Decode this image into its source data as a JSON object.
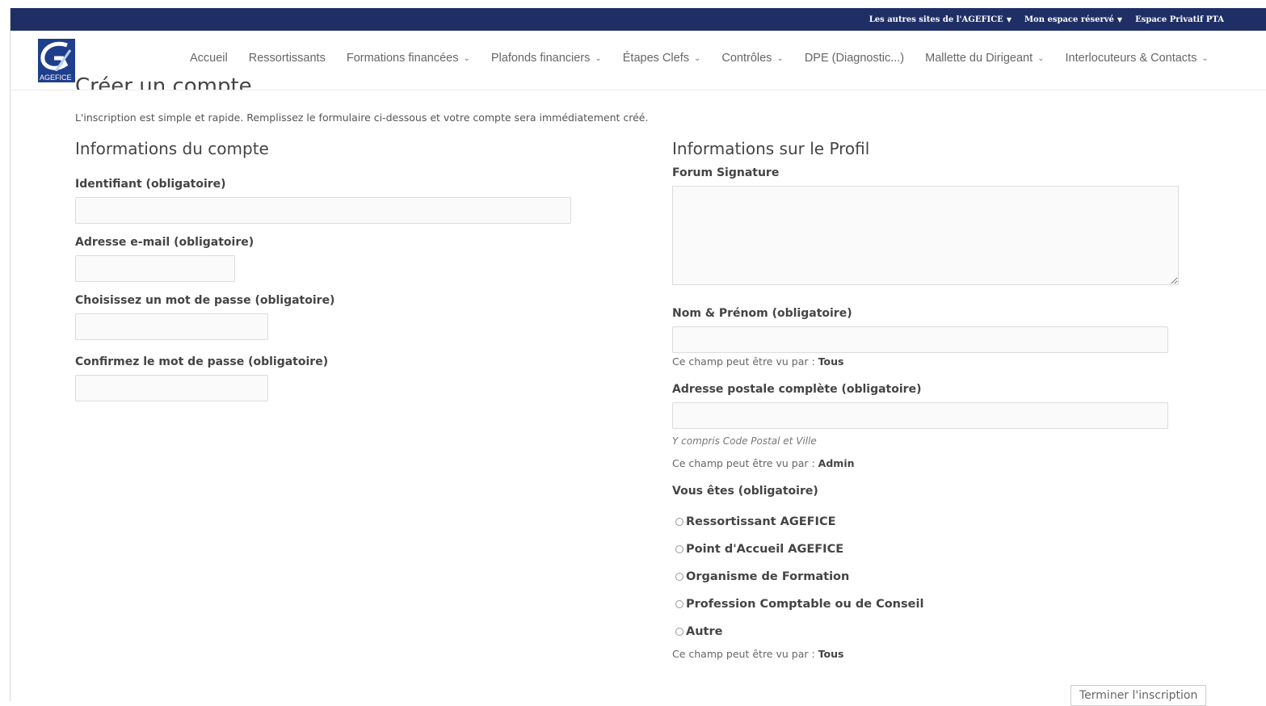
{
  "topbar": {
    "items": [
      {
        "label": "Les autres sites de l'AGEFICE"
      },
      {
        "label": "Mon espace réservé"
      },
      {
        "label": "Espace Privatif PTA"
      }
    ]
  },
  "header": {
    "logo_text": "AGEFICE",
    "nav": [
      {
        "label": "Accueil",
        "has_dropdown": false
      },
      {
        "label": "Ressortissants",
        "has_dropdown": false
      },
      {
        "label": "Formations financées",
        "has_dropdown": true
      },
      {
        "label": "Plafonds financiers",
        "has_dropdown": true
      },
      {
        "label": "Étapes Clefs",
        "has_dropdown": true
      },
      {
        "label": "Contrôles",
        "has_dropdown": true
      },
      {
        "label": "DPE (Diagnostic...)",
        "has_dropdown": false
      },
      {
        "label": "Mallette du Dirigeant",
        "has_dropdown": true
      },
      {
        "label": "Interlocuteurs & Contacts",
        "has_dropdown": true
      }
    ]
  },
  "page": {
    "title": "Créer un compte",
    "intro": "L'inscription est simple et rapide. Remplissez le formulaire ci-dessous et votre compte sera immédiatement créé."
  },
  "account": {
    "title": "Informations du compte",
    "username_label": "Identifiant (obligatoire)",
    "email_label": "Adresse e-mail (obligatoire)",
    "password_label": "Choisissez un mot de passe (obligatoire)",
    "confirm_label": "Confirmez le mot de passe (obligatoire)"
  },
  "profile": {
    "title": "Informations sur le Profil",
    "signature_label": "Forum Signature",
    "name_label": "Nom & Prénom (obligatoire)",
    "name_visibility_prefix": "Ce champ peut être vu par :",
    "name_visibility_value": "Tous",
    "address_label": "Adresse postale complète (obligatoire)",
    "address_hint": "Y compris Code Postal et Ville",
    "address_visibility_prefix": "Ce champ peut être vu par :",
    "address_visibility_value": "Admin",
    "role_label": "Vous êtes (obligatoire)",
    "role_options": [
      "Ressortissant AGEFICE",
      "Point d'Accueil AGEFICE",
      "Organisme de Formation",
      "Profession Comptable ou de Conseil",
      "Autre"
    ],
    "role_visibility_prefix": "Ce champ peut être vu par :",
    "role_visibility_value": "Tous"
  },
  "submit_label": "Terminer l'inscription",
  "colors": {
    "topbar_bg": "#1f2f66",
    "logo_blue": "#1f3e8c"
  }
}
